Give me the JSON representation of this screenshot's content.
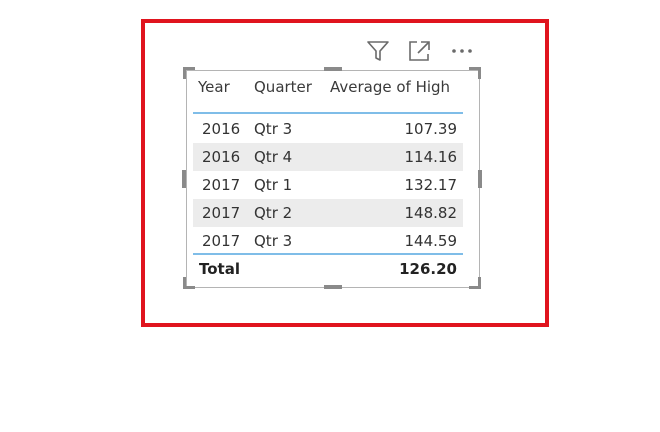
{
  "table": {
    "headers": {
      "year": "Year",
      "quarter": "Quarter",
      "average": "Average of High"
    },
    "rows": [
      {
        "year": "2016",
        "quarter": "Qtr 3",
        "value": "107.39"
      },
      {
        "year": "2016",
        "quarter": "Qtr 4",
        "value": "114.16"
      },
      {
        "year": "2017",
        "quarter": "Qtr 1",
        "value": "132.17"
      },
      {
        "year": "2017",
        "quarter": "Qtr 2",
        "value": "148.82"
      },
      {
        "year": "2017",
        "quarter": "Qtr 3",
        "value": "144.59"
      }
    ],
    "total": {
      "label": "Total",
      "value": "126.20"
    }
  },
  "toolbar": {
    "icons": [
      "filter-icon",
      "focus-mode-icon",
      "more-options-icon"
    ]
  },
  "colors": {
    "highlight_frame": "#e0141e",
    "header_separator": "#7fbde8",
    "row_shade": "#ececec"
  }
}
